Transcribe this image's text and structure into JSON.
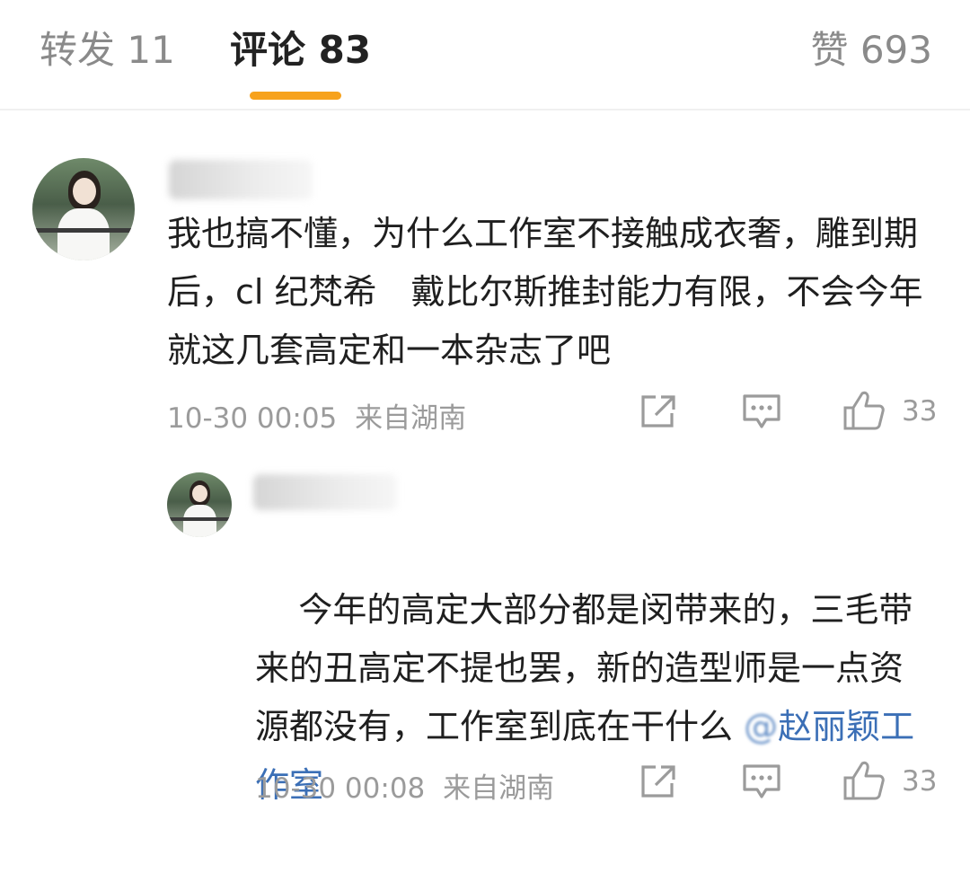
{
  "tabs": {
    "repost": "转发 11",
    "comment": "评论 83",
    "like": "赞 693"
  },
  "colors": {
    "accent": "#f7a21c",
    "mention": "#3b6fb6",
    "muted": "#9b9b9b"
  },
  "comments": [
    {
      "text": "我也搞不懂，为什么工作室不接触成衣奢，雕到期后，cl 纪梵希　戴比尔斯推封能力有限，不会今年就这几套高定和一本杂志了吧",
      "timestamp": "10-30 00:05",
      "location": "来自湖南",
      "likes": "33",
      "icons": [
        "share-icon",
        "comment-icon",
        "thumbs-up-icon"
      ]
    },
    {
      "text": "今年的高定大部分都是闵带来的，三毛带来的丑高定不提也罢，新的造型师是一点资源都没有，工作室到底在干什么 ",
      "mention": "赵丽颖工作室",
      "timestamp": "10-30 00:08",
      "location": "来自湖南",
      "likes": "33",
      "icons": [
        "share-icon",
        "comment-icon",
        "thumbs-up-icon"
      ]
    }
  ]
}
